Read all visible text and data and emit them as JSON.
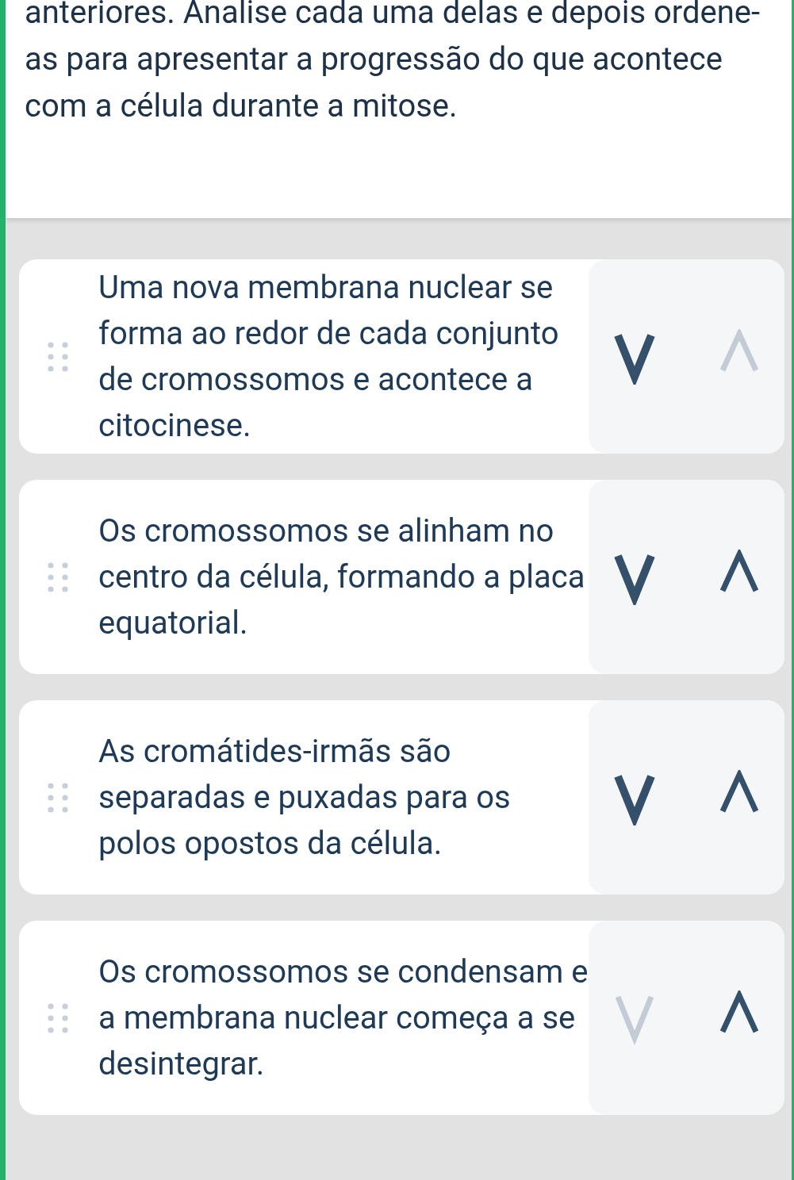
{
  "instructions": "anteriores. Analise cada uma delas e depois ordene-as para apresentar a progressão do que acontece com a célula durante a mitose.",
  "items": [
    {
      "text": "Uma nova membrana nuclear se forma ao redor de cada conjunto de cromossomos e acontece a citocinese.",
      "move_down": {
        "disabled": false
      },
      "move_up": {
        "disabled": true
      }
    },
    {
      "text": "Os cromossomos se alinham no centro da célula, formando a placa equatorial.",
      "move_down": {
        "disabled": false
      },
      "move_up": {
        "disabled": false
      }
    },
    {
      "text": "As cromátides-irmãs são separadas e puxadas para os polos opostos da célula.",
      "move_down": {
        "disabled": false
      },
      "move_up": {
        "disabled": false
      }
    },
    {
      "text": "Os cromossomos se condensam e a membrana nuclear começa a se desintegrar.",
      "move_down": {
        "disabled": true
      },
      "move_up": {
        "disabled": false
      }
    }
  ]
}
